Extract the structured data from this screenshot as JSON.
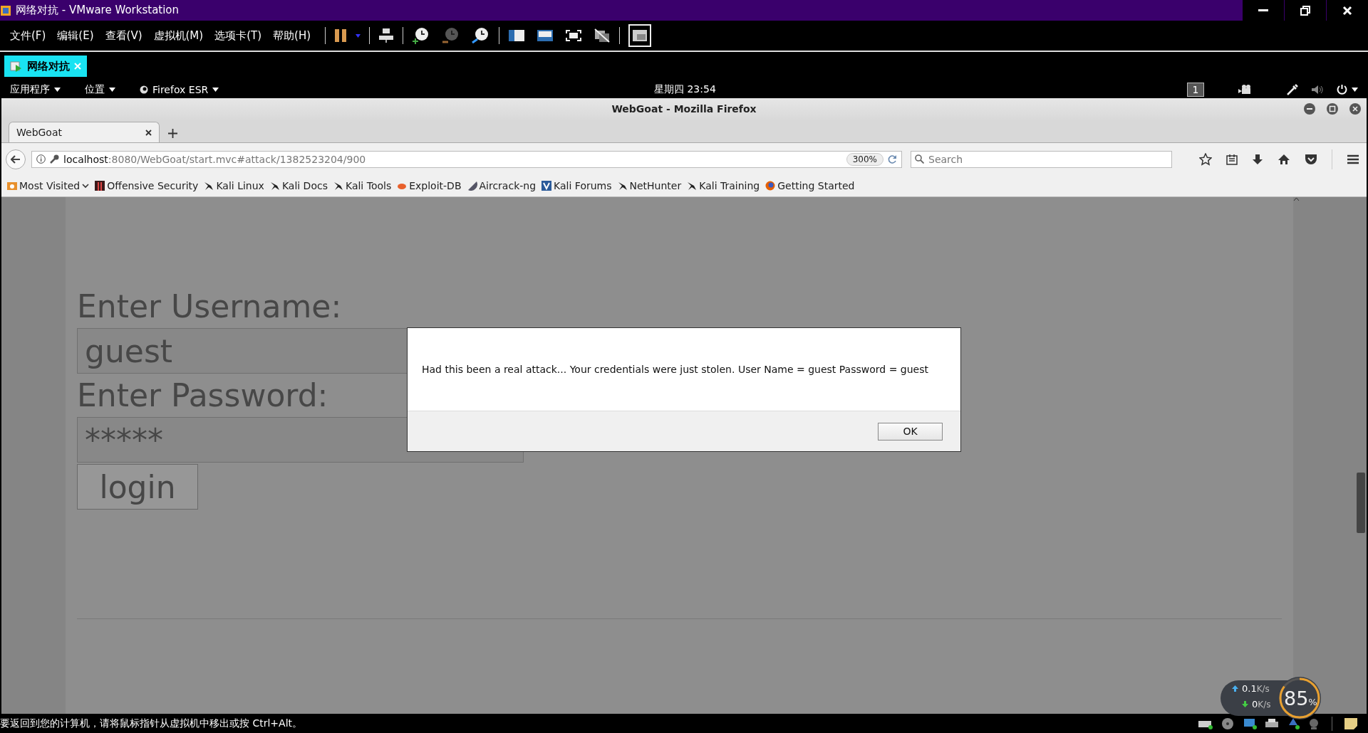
{
  "vmware": {
    "title": "网络对抗 - VMware Workstation",
    "menu": [
      "文件(F)",
      "编辑(E)",
      "查看(V)",
      "虚拟机(M)",
      "选项卡(T)",
      "帮助(H)"
    ],
    "vm_tabs": [
      {
        "label": "网络对抗",
        "selected": true
      }
    ]
  },
  "kali_panel": {
    "menus": [
      "应用程序",
      "位置",
      "Firefox ESR"
    ],
    "clock": "星期四 23:54",
    "workspace": "1"
  },
  "firefox": {
    "title": "WebGoat - Mozilla Firefox",
    "tabs": [
      {
        "label": "WebGoat",
        "selected": true
      }
    ],
    "url": {
      "host": "localhost",
      "path": ":8080/WebGoat/start.mvc#attack/1382523204/900"
    },
    "zoom": "300%",
    "search": {
      "placeholder": "Search"
    },
    "bookmarks": [
      {
        "label": "Most Visited",
        "kind": "folder"
      },
      {
        "label": "Offensive Security",
        "kind": "offsec"
      },
      {
        "label": "Kali Linux",
        "kind": "kali"
      },
      {
        "label": "Kali Docs",
        "kind": "kali"
      },
      {
        "label": "Kali Tools",
        "kind": "kali"
      },
      {
        "label": "Exploit-DB",
        "kind": "exploit"
      },
      {
        "label": "Aircrack-ng",
        "kind": "aircrack"
      },
      {
        "label": "Kali Forums",
        "kind": "forums"
      },
      {
        "label": "NetHunter",
        "kind": "kali"
      },
      {
        "label": "Kali Training",
        "kind": "kali"
      },
      {
        "label": "Getting Started",
        "kind": "firefox"
      }
    ]
  },
  "page": {
    "username_label": "Enter Username:",
    "username": "guest",
    "password_label": "Enter Password:",
    "password": "*****",
    "login": "login"
  },
  "dialog": {
    "message": "Had this been a real attack... Your credentials were just stolen. User Name = guest Password = guest",
    "ok": "OK"
  },
  "net_widget": {
    "up": "0.1",
    "up_unit": "K/s",
    "down": "0",
    "down_unit": "K/s",
    "cpu": "85",
    "cpu_unit": "%"
  },
  "status_bar": "要返回到您的计算机，请将鼠标指针从虚拟机中移出或按 Ctrl+Alt。"
}
